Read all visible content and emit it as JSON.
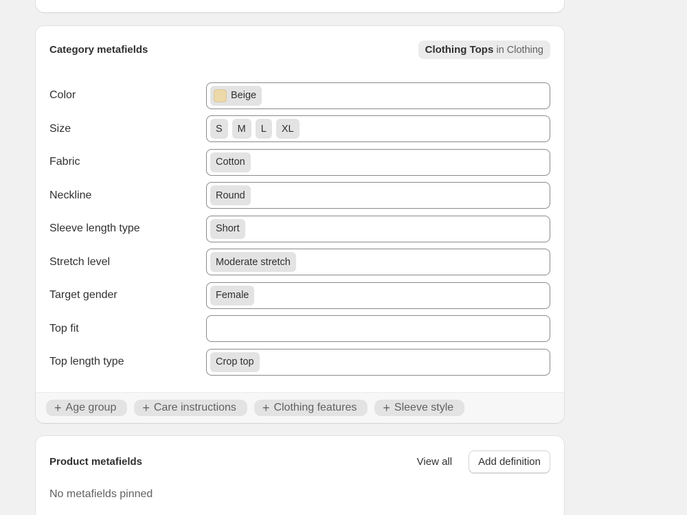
{
  "category_card": {
    "title": "Category metafields",
    "category": {
      "name": "Clothing Tops",
      "in_label": "in Clothing"
    },
    "rows": [
      {
        "label": "Color",
        "values": [
          "Beige"
        ],
        "swatch_color": "#ecd8a8"
      },
      {
        "label": "Size",
        "values": [
          "S",
          "M",
          "L",
          "XL"
        ]
      },
      {
        "label": "Fabric",
        "values": [
          "Cotton"
        ]
      },
      {
        "label": "Neckline",
        "values": [
          "Round"
        ]
      },
      {
        "label": "Sleeve length type",
        "values": [
          "Short"
        ]
      },
      {
        "label": "Stretch level",
        "values": [
          "Moderate stretch"
        ]
      },
      {
        "label": "Target gender",
        "values": [
          "Female"
        ]
      },
      {
        "label": "Top fit",
        "values": []
      },
      {
        "label": "Top length type",
        "values": [
          "Crop top"
        ]
      }
    ],
    "add_buttons": [
      {
        "icon": "plus-icon",
        "label": "Age group"
      },
      {
        "icon": "plus-icon",
        "label": "Care instructions"
      },
      {
        "icon": "plus-icon",
        "label": "Clothing features"
      },
      {
        "icon": "plus-icon",
        "label": "Sleeve style"
      }
    ]
  },
  "product_card": {
    "title": "Product metafields",
    "view_all_label": "View all",
    "add_definition_label": "Add definition",
    "empty_text": "No metafields pinned"
  },
  "colors": {
    "page_background": "#f1f1f1",
    "card_background": "#ffffff",
    "tag_background": "#e3e3e3",
    "field_border": "#8a8a8a"
  }
}
